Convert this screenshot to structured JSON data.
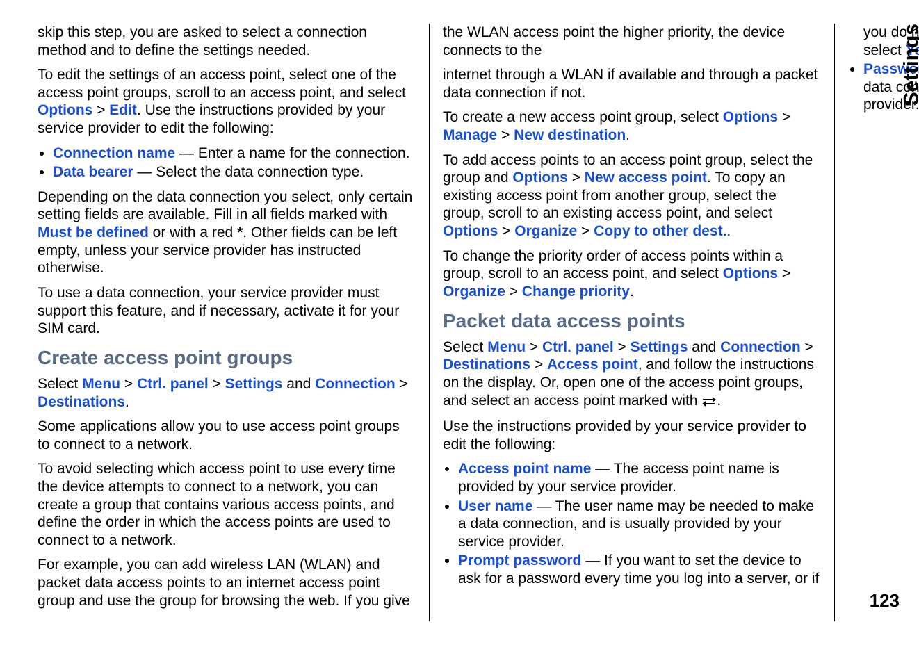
{
  "meta": {
    "side_tab": "Settings",
    "page_number": "123"
  },
  "col_left": {
    "p1": "skip this step, you are asked to select a connection method and to define the settings needed.",
    "p2a": "To edit the settings of an access point, select one of the access point groups, scroll to an access point, and select ",
    "p2_options": "Options",
    "p2_gt": " > ",
    "p2_edit": "Edit",
    "p2b": ". Use the instructions provided by your service provider to edit the following:",
    "li1_label": "Connection name",
    "li1_text": " — Enter a name for the connection.",
    "li2_label": "Data bearer",
    "li2_text": " — Select the data connection type.",
    "p3a": "Depending on the data connection you select, only certain setting fields are available. Fill in all fields marked with ",
    "p3_must": "Must be defined",
    "p3b": " or with a red ",
    "p3_star": "*",
    "p3c": ". Other fields can be left empty, unless your service provider has instructed otherwise.",
    "p4": "To use a data connection, your service provider must support this feature, and if necessary, activate it for your SIM card.",
    "h1": "Create access point groups",
    "p5a": "Select ",
    "p5_menu": "Menu",
    "p5_gt1": " > ",
    "p5_ctrl": "Ctrl. panel",
    "p5_gt2": " > ",
    "p5_settings": "Settings",
    "p5b": " and ",
    "p5_conn": "Connection",
    "p5_gt3": " > ",
    "p5_dest": "Destinations",
    "p5c": ".",
    "p6": "Some applications allow you to use access point groups to connect to a network.",
    "p7": "To avoid selecting which access point to use every time the device attempts to connect to a network, you can create a group that contains various access points, and define the order in which the access points are used to connect to a network.",
    "p8": "For example, you can add wireless LAN (WLAN) and packet data access points to an internet access point group and use the group for browsing the web. If you give the WLAN access point the higher priority, the device connects to the"
  },
  "col_right": {
    "p1": "internet through a WLAN if available and through a packet data connection if not.",
    "p2a": "To create a new access point group, select ",
    "p2_options": "Options",
    "p2_gt1": " > ",
    "p2_manage": "Manage",
    "p2_gt2": " > ",
    "p2_newdest": "New destination",
    "p2b": ".",
    "p3a": "To add access points to an access point group, select the group and ",
    "p3_options": "Options",
    "p3_gt1": " > ",
    "p3_newap": "New access point",
    "p3b": ". To copy an existing access point from another group, select the group, scroll to an existing access point, and select ",
    "p3_options2": "Options",
    "p3_gt2": " > ",
    "p3_org": "Organize",
    "p3_gt3": " > ",
    "p3_copy": "Copy to other dest.",
    "p3c": ".",
    "p4a": "To change the priority order of access points within a group, scroll to an access point, and select ",
    "p4_options": "Options",
    "p4_gt1": " > ",
    "p4_org": "Organize",
    "p4_gt2": " > ",
    "p4_chpri": "Change priority",
    "p4b": ".",
    "h1": "Packet data access points",
    "p5a": "Select ",
    "p5_menu": "Menu",
    "p5_gt1": " > ",
    "p5_ctrl": "Ctrl. panel",
    "p5_gt2": " > ",
    "p5_settings": "Settings",
    "p5b": " and ",
    "p5_conn": "Connection",
    "p5_gt3": " > ",
    "p5_dest": "Destinations",
    "p5_gt4": " > ",
    "p5_ap": "Access point",
    "p5c": ", and follow the instructions on the display. Or, open one of the access point groups, and select an access point marked with ",
    "p5d": ".",
    "p6": "Use the instructions provided by your service provider to edit the following:",
    "li1_label": "Access point name",
    "li1_text": " — The access point name is provided by your service provider.",
    "li2_label": "User name",
    "li2_text": " — The user name may be needed to make a data connection, and is usually provided by your service provider.",
    "li3_label": "Prompt password",
    "li3_texta": " — If you want to set the device to ask for a password every time you log into a server, or if you do not want to save your password in the device, select ",
    "li3_yes": "Yes",
    "li3_textb": ".",
    "li4_label": "Password",
    "li4_text": " — A password may be needed to make a data connection and is usually provided by your service provider."
  }
}
